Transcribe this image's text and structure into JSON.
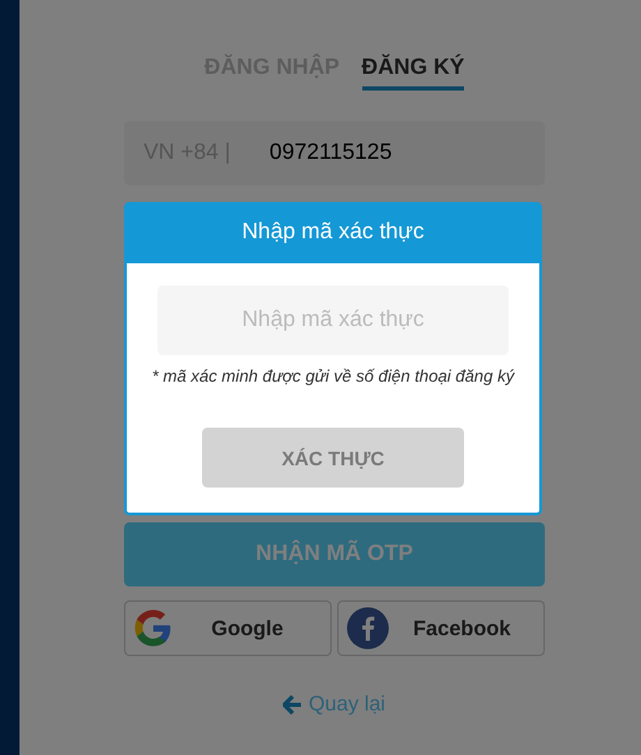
{
  "tabs": [
    {
      "label": "ĐĂNG NHẬP",
      "selected": false
    },
    {
      "label": "ĐĂNG KÝ",
      "selected": true
    }
  ],
  "phone": {
    "prefix": "VN +84 |",
    "value": "0972115125"
  },
  "otp_button": {
    "label": "NHẬN MÃ OTP"
  },
  "social": [
    {
      "kind": "google",
      "label": "Google"
    },
    {
      "kind": "facebook",
      "label": "Facebook"
    }
  ],
  "back_link": {
    "label": "Quay lại"
  },
  "modal": {
    "title": "Nhập mã xác thực",
    "code_field": {
      "placeholder": "Nhập mã xác thực"
    },
    "note": "* mã xác minh được gửi về số điện thoại đăng ký",
    "button": {
      "label": "XÁC THỰC",
      "disabled": true
    }
  }
}
